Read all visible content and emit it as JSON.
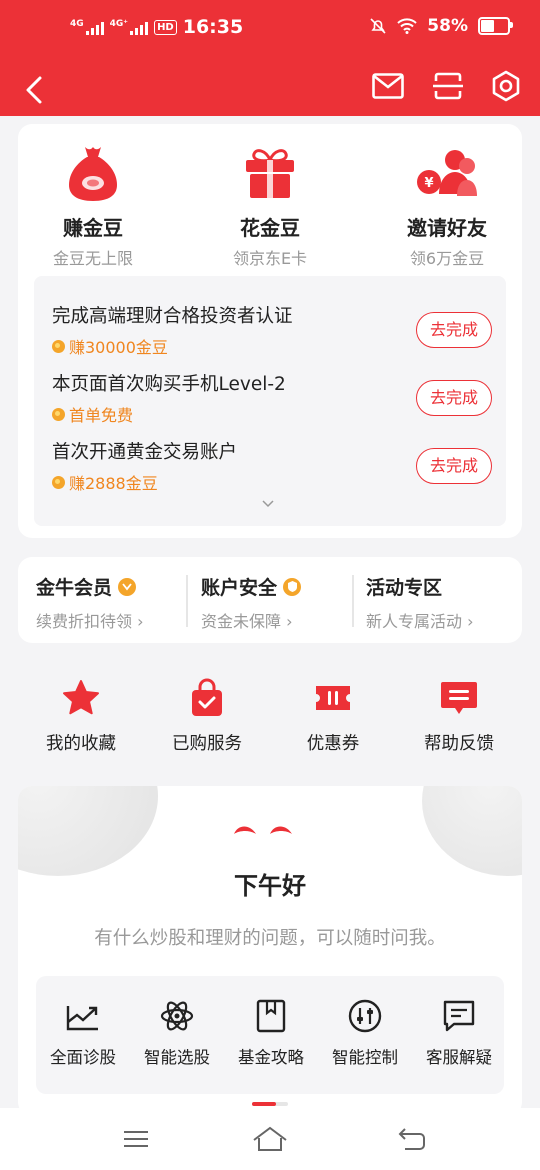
{
  "status_bar": {
    "net1": "4G",
    "net2": "4G⁺",
    "hd": "HD",
    "time": "16:35",
    "battery": "58%",
    "battery_level": 0.58
  },
  "colors": {
    "brand": "#ec3137",
    "gold": "#f0861f",
    "muted": "#999999"
  },
  "features": [
    {
      "title": "赚金豆",
      "sub": "金豆无上限",
      "icon": "money-bag-icon"
    },
    {
      "title": "花金豆",
      "sub": "领京东E卡",
      "icon": "gift-box-icon"
    },
    {
      "title": "邀请好友",
      "sub": "领6万金豆",
      "icon": "invite-friends-icon"
    }
  ],
  "tasks": [
    {
      "title": "完成高端理财合格投资者认证",
      "reward": "赚30000金豆",
      "action": "去完成"
    },
    {
      "title": "本页面首次购买手机Level-2",
      "reward": "首单免费",
      "action": "去完成"
    },
    {
      "title": "首次开通黄金交易账户",
      "reward": "赚2888金豆",
      "action": "去完成"
    }
  ],
  "membership": [
    {
      "title": "金牛会员",
      "sub": "续费折扣待领 ›"
    },
    {
      "title": "账户安全",
      "sub": "资金未保障 ›"
    },
    {
      "title": "活动专区",
      "sub": "新人专属活动 ›"
    }
  ],
  "quick_actions": [
    {
      "label": "我的收藏",
      "icon": "star-icon"
    },
    {
      "label": "已购服务",
      "icon": "shopping-bag-icon"
    },
    {
      "label": "优惠券",
      "icon": "coupon-icon"
    },
    {
      "label": "帮助反馈",
      "icon": "feedback-icon"
    }
  ],
  "assistant": {
    "greeting": "下午好",
    "subtitle": "有什么炒股和理财的问题，可以随时问我。",
    "tools": [
      {
        "label": "全面诊股",
        "icon": "chart-trend-icon"
      },
      {
        "label": "智能选股",
        "icon": "atom-icon"
      },
      {
        "label": "基金攻略",
        "icon": "bookmark-book-icon"
      },
      {
        "label": "智能控制",
        "icon": "sliders-icon"
      },
      {
        "label": "客服解疑",
        "icon": "chat-icon"
      }
    ]
  }
}
